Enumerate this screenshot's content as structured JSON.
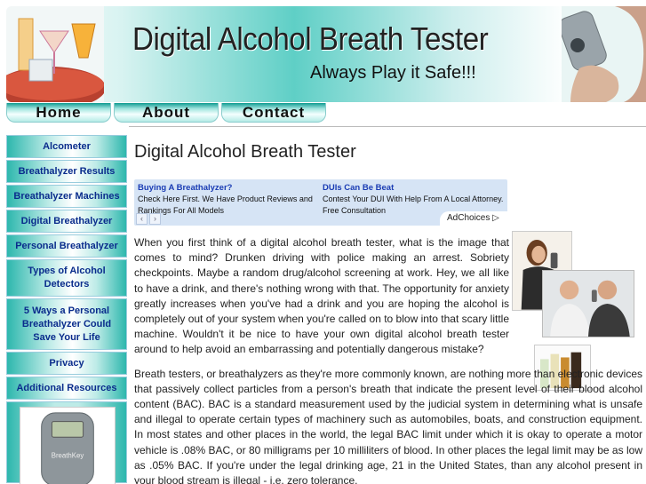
{
  "banner": {
    "title": "Digital Alcohol Breath Tester",
    "slogan": "Always Play it Safe!!!"
  },
  "topnav": {
    "items": [
      "Home",
      "About",
      "Contact"
    ]
  },
  "sidebar": {
    "items": [
      "Alcometer",
      "Breathalyzer Results",
      "Breathalyzer Machines",
      "Digital Breathalyzer",
      "Personal Breathalyzer",
      "Types of Alcohol Detectors",
      "5 Ways a Personal Breathalyzer Could Save Your Life",
      "Privacy",
      "Additional Resources"
    ],
    "product_label": "BreathKey"
  },
  "main": {
    "heading": "Digital Alcohol Breath Tester",
    "ads": [
      {
        "title": "Buying A Breathalyzer?",
        "text": "Check Here First. We Have Product Reviews and Rankings For All Models"
      },
      {
        "title": "DUIs Can Be Beat",
        "text": "Contest Your DUI With Help From A Local Attorney. Free Consultation"
      }
    ],
    "ad_prev": "‹",
    "ad_next": "›",
    "adchoices": "AdChoices ▷",
    "paragraphs": [
      "When you first think of a digital alcohol breath tester, what is the image that comes to mind? Drunken driving with police making an arrest. Sobriety checkpoints. Maybe a random drug/alcohol screening at work. Hey, we all like to have a drink, and there's nothing wrong with that. The opportunity for anxiety greatly increases when you've had a drink and you are hoping the alcohol is completely out of your system when you're called on to blow into that scary little machine. Wouldn't it be nice to have your own digital alcohol breath tester around to help avoid an embarrassing and potentially dangerous mistake?",
      "Breath testers, or breathalyzers as they're more commonly known, are nothing more than electronic devices that passively collect particles from a person's breath that indicate the present level of their blood alcohol content (BAC). BAC is a standard measurement used by the judicial system in determining what is unsafe and illegal to operate certain types of machinery such as automobiles, boats, and construction equipment. In most states and other places in the world, the legal BAC limit under which it is okay to operate a motor vehicle is .08% BAC, or 80 milligrams per 10 milliliters of blood. In other places the legal limit may be as low as .05% BAC. If you're under the legal drinking age, 21 in the United States, than any alcohol present in your blood stream is illegal - i.e. zero tolerance."
    ]
  }
}
